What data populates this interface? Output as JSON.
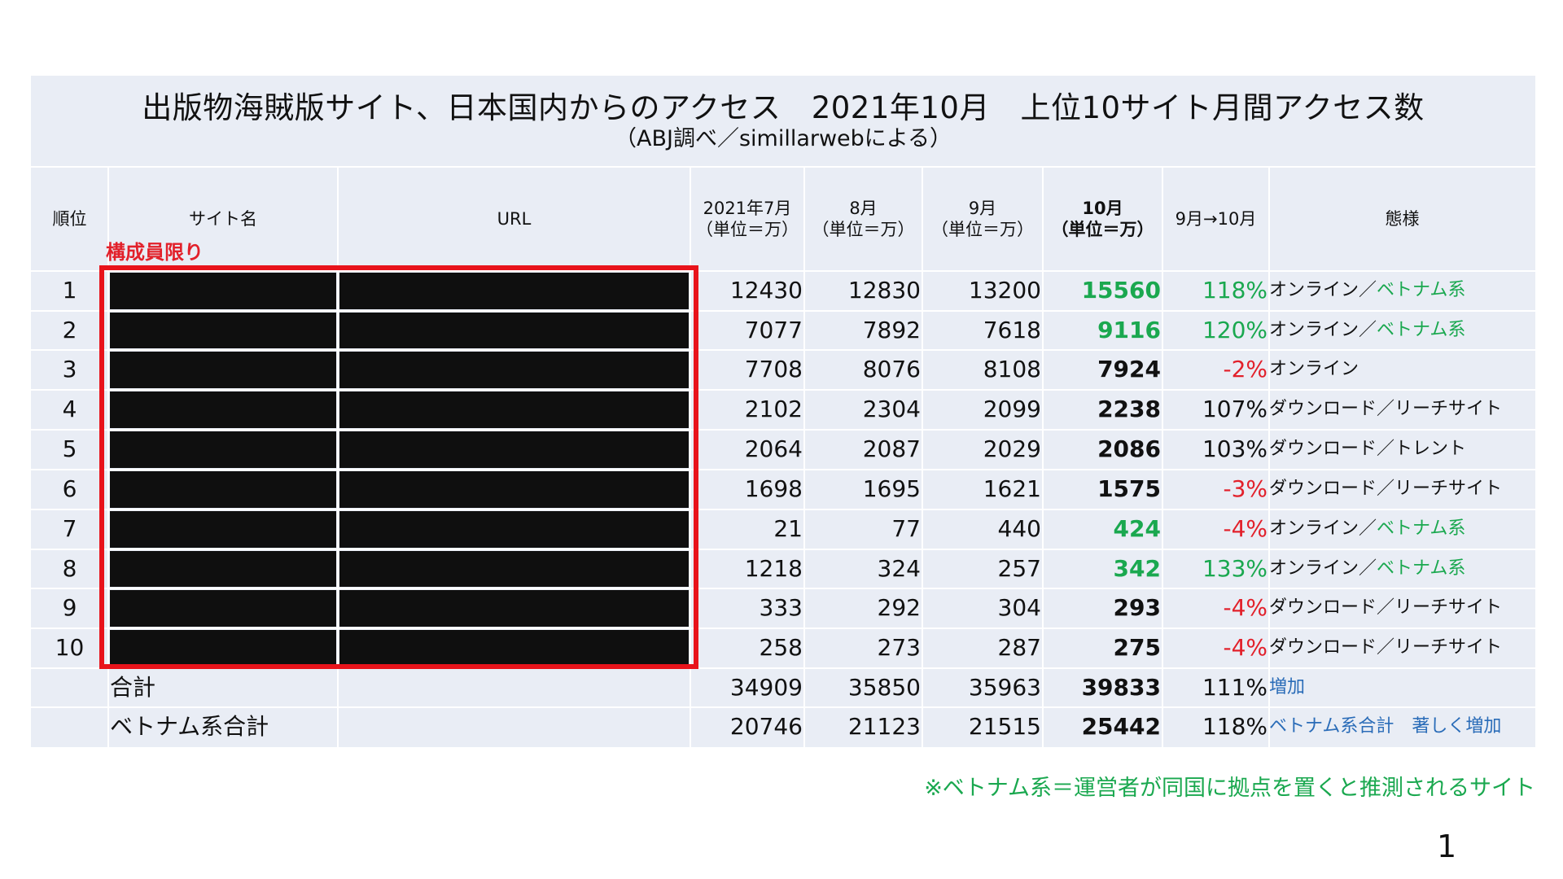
{
  "title": "出版物海賊版サイト、日本国内からのアクセス　2021年10月　上位10サイト月間アクセス数",
  "subtitle": "（ABJ調べ／simillarwebによる）",
  "members_only": "構成員限り",
  "headers": {
    "rank": "順位",
    "site_name": "サイト名",
    "url": "URL",
    "jul_line1": "2021年7月",
    "jul_line2": "（単位＝万）",
    "aug_line1": "8月",
    "aug_line2": "（単位＝万）",
    "sep_line1": "9月",
    "sep_line2": "（単位＝万）",
    "oct_line1": "10月",
    "oct_line2": "（単位＝万）",
    "change": "9月→10月",
    "type": "態様"
  },
  "rows": [
    {
      "rank": "1",
      "jul": "12430",
      "aug": "12830",
      "sep": "13200",
      "oct": "15560",
      "change": "118%",
      "type_main": "オンライン／",
      "type_sub": "ベトナム系"
    },
    {
      "rank": "2",
      "jul": "7077",
      "aug": "7892",
      "sep": "7618",
      "oct": "9116",
      "change": "120%",
      "type_main": "オンライン／",
      "type_sub": "ベトナム系"
    },
    {
      "rank": "3",
      "jul": "7708",
      "aug": "8076",
      "sep": "8108",
      "oct": "7924",
      "change": "-2%",
      "type_main": "オンライン",
      "type_sub": ""
    },
    {
      "rank": "4",
      "jul": "2102",
      "aug": "2304",
      "sep": "2099",
      "oct": "2238",
      "change": "107%",
      "type_main": "ダウンロード／リーチサイト",
      "type_sub": ""
    },
    {
      "rank": "5",
      "jul": "2064",
      "aug": "2087",
      "sep": "2029",
      "oct": "2086",
      "change": "103%",
      "type_main": "ダウンロード／トレント",
      "type_sub": ""
    },
    {
      "rank": "6",
      "jul": "1698",
      "aug": "1695",
      "sep": "1621",
      "oct": "1575",
      "change": "-3%",
      "type_main": "ダウンロード／リーチサイト",
      "type_sub": ""
    },
    {
      "rank": "7",
      "jul": "21",
      "aug": "77",
      "sep": "440",
      "oct": "424",
      "change": "-4%",
      "type_main": "オンライン／",
      "type_sub": "ベトナム系"
    },
    {
      "rank": "8",
      "jul": "1218",
      "aug": "324",
      "sep": "257",
      "oct": "342",
      "change": "133%",
      "type_main": "オンライン／",
      "type_sub": "ベトナム系"
    },
    {
      "rank": "9",
      "jul": "333",
      "aug": "292",
      "sep": "304",
      "oct": "293",
      "change": "-4%",
      "type_main": "ダウンロード／リーチサイト",
      "type_sub": ""
    },
    {
      "rank": "10",
      "jul": "258",
      "aug": "273",
      "sep": "287",
      "oct": "275",
      "change": "-4%",
      "type_main": "ダウンロード／リーチサイト",
      "type_sub": ""
    }
  ],
  "totals": [
    {
      "label": "合計",
      "jul": "34909",
      "aug": "35850",
      "sep": "35963",
      "oct": "39833",
      "change": "111%",
      "note": "増加"
    },
    {
      "label": "ベトナム系合計",
      "jul": "20746",
      "aug": "21123",
      "sep": "21515",
      "oct": "25442",
      "change": "118%",
      "note": "ベトナム系合計　著しく増加"
    }
  ],
  "footnote": "※ベトナム系＝運営者が同国に拠点を置くと推測されるサイト",
  "page_number": "1",
  "colors": {
    "green": "#1aa84f",
    "red": "#e2202a",
    "blue": "#2a6cb8",
    "frame": "#e8131b",
    "table_bg": "#e9edf5"
  }
}
